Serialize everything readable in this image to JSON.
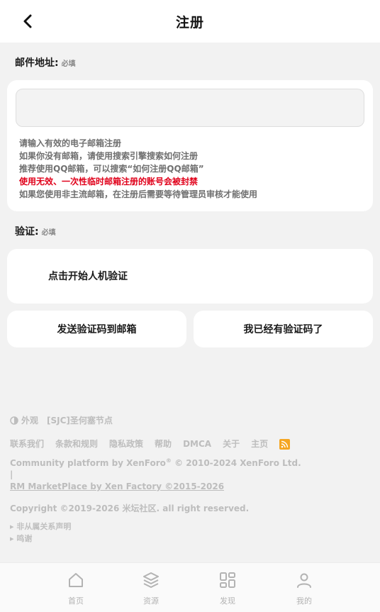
{
  "header": {
    "title": "注册"
  },
  "email_section": {
    "label": "邮件地址:",
    "required": "必填",
    "input_value": "",
    "input_placeholder": "",
    "hints": [
      "请输入有效的电子邮箱注册",
      "如果你没有邮箱，请使用搜索引擎搜索如何注册",
      "推荐使用QQ邮箱，可以搜索“如何注册QQ邮箱”",
      "使用无效、一次性临时邮箱注册的账号会被封禁",
      "如果您使用非主流邮箱，在注册后需要等待管理员审核才能使用"
    ]
  },
  "verify_section": {
    "label": "验证:",
    "required": "必填",
    "captcha_text": "点击开始人机验证",
    "send_code_label": "发送验证码到邮箱",
    "have_code_label": "我已经有验证码了"
  },
  "footer": {
    "appearance": "外观",
    "style_name": "[SJC]圣何塞节点",
    "links": [
      "联系我们",
      "条款和规则",
      "隐私政策",
      "帮助",
      "DMCA",
      "关于",
      "主页"
    ],
    "powered_by": "Community platform by XenForo",
    "powered_by_sup": "®",
    "powered_by_years": "© 2010-2024 XenForo Ltd.",
    "separator": "|",
    "addon_credit": "RM MarketPlace by Xen Factory ©2015-2026",
    "copyright": "Copyright ©2019-2026 米坛社区. all right reserved.",
    "notes": [
      "非从属关系声明",
      "鸣谢"
    ]
  },
  "tabbar": {
    "items": [
      {
        "label": "首页",
        "icon": "home-icon"
      },
      {
        "label": "资源",
        "icon": "layers-icon"
      },
      {
        "label": "发现",
        "icon": "grid-icon"
      },
      {
        "label": "我的",
        "icon": "user-icon"
      }
    ]
  },
  "colors": {
    "warning": "#e0001a",
    "rss": "#f5a623",
    "background": "#f2f2f2"
  }
}
